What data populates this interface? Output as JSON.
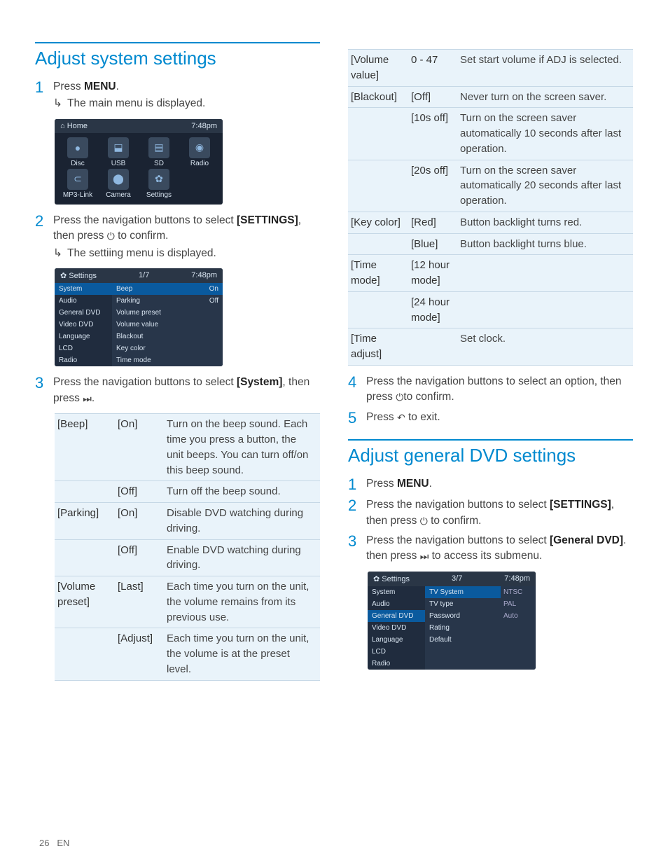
{
  "page": {
    "number": "26",
    "lang": "EN"
  },
  "sectionA": {
    "title": "Adjust system settings",
    "step1": {
      "text_a": "Press ",
      "bold": "MENU",
      "text_b": ".",
      "sub": "The main menu is displayed."
    },
    "step2": {
      "text_a": "Press the navigation buttons to select ",
      "bold": "[SETTINGS]",
      "text_b": ", then press ",
      "text_c": " to confirm.",
      "sub": "The settiing menu is displayed."
    },
    "step3": {
      "text_a": "Press the navigation buttons to select ",
      "bold": "[System]",
      "text_b": ", then press "
    },
    "step4": {
      "text_a": "Press the navigation buttons to select an option, then press ",
      "text_b": "to confirm."
    },
    "step5": {
      "text_a": "Press ",
      "text_b": " to exit."
    }
  },
  "sectionB": {
    "title": "Adjust general DVD settings",
    "step1": {
      "text_a": "Press ",
      "bold": "MENU",
      "text_b": "."
    },
    "step2": {
      "text_a": "Press the navigation buttons to select ",
      "bold": "[SETTINGS]",
      "text_b": ", then press ",
      "text_c": " to confirm."
    },
    "step3": {
      "text_a": "Press the navigation buttons to select ",
      "bold": "[General DVD]",
      "text_b": ". then press ",
      "text_c": " to access its submenu."
    }
  },
  "homeScreen": {
    "header_left": "Home",
    "header_right": "7:48pm",
    "items": [
      "Disc",
      "USB",
      "SD",
      "Radio",
      "MP3-Link",
      "Camera",
      "Settings"
    ],
    "icons": [
      "●",
      "⬓",
      "▤",
      "◉",
      "⊂",
      "⬤",
      "✿"
    ]
  },
  "settingsScreen1": {
    "header_left": "Settings",
    "header_mid": "1/7",
    "header_right": "7:48pm",
    "left": [
      "System",
      "Audio",
      "General DVD",
      "Video DVD",
      "Language",
      "LCD",
      "Radio"
    ],
    "left_sel": 0,
    "mid": [
      "Beep",
      "Parking",
      "Volume preset",
      "Volume value",
      "Blackout",
      "Key color",
      "Time mode"
    ],
    "right": [
      "On",
      "Off",
      "",
      "",
      "",
      "",
      ""
    ]
  },
  "settingsScreen2": {
    "header_left": "Settings",
    "header_mid": "3/7",
    "header_right": "7:48pm",
    "left": [
      "System",
      "Audio",
      "General DVD",
      "Video DVD",
      "Language",
      "LCD",
      "Radio"
    ],
    "left_sel": 2,
    "mid": [
      "TV System",
      "TV type",
      "Password",
      "Rating",
      "Default"
    ],
    "mid_sel": 0,
    "right": [
      "NTSC",
      "PAL",
      "Auto",
      "",
      ""
    ]
  },
  "tableA": [
    {
      "c1": "[Beep]",
      "c2": "[On]",
      "c3": "Turn on the beep sound. Each time you press a button, the unit beeps. You can turn off/on this beep sound."
    },
    {
      "c1": "",
      "c2": "[Off]",
      "c3": "Turn off the beep sound."
    },
    {
      "c1": "[Parking]",
      "c2": "[On]",
      "c3": "Disable DVD watching during driving."
    },
    {
      "c1": "",
      "c2": "[Off]",
      "c3": "Enable DVD watching during driving."
    },
    {
      "c1": "[Volume preset]",
      "c2": "[Last]",
      "c3": "Each time you turn on the unit, the volume remains from its previous use."
    },
    {
      "c1": "",
      "c2": "[Adjust]",
      "c3": "Each time you turn on the unit, the volume is at the preset level."
    }
  ],
  "tableB": [
    {
      "c1": "[Volume value]",
      "c2": "0 - 47",
      "c3": "Set start volume if ADJ is selected."
    },
    {
      "c1": "[Blackout]",
      "c2": "[Off]",
      "c3": "Never turn on the screen saver."
    },
    {
      "c1": "",
      "c2": "[10s off]",
      "c3": "Turn on the screen saver automatically 10 seconds after last operation."
    },
    {
      "c1": "",
      "c2": "[20s off]",
      "c3": "Turn on the screen saver automatically 20 seconds after last operation."
    },
    {
      "c1": "[Key color]",
      "c2": "[Red]",
      "c3": "Button backlight turns red."
    },
    {
      "c1": "",
      "c2": "[Blue]",
      "c3": "Button backlight turns blue."
    },
    {
      "c1": "[Time mode]",
      "c2": "[12 hour mode]",
      "c3": ""
    },
    {
      "c1": "",
      "c2": "[24 hour mode]",
      "c3": ""
    },
    {
      "c1": "[Time adjust]",
      "c2": "",
      "c3": "Set clock."
    }
  ]
}
